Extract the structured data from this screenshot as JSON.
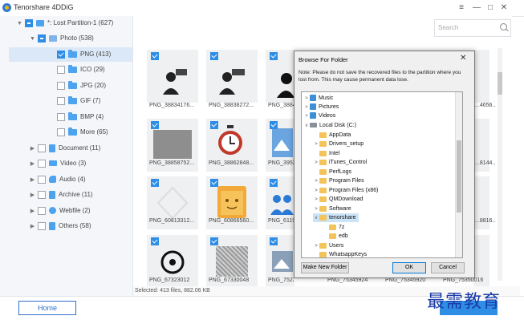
{
  "app": {
    "title": "Tenorshare 4DDiG"
  },
  "window_controls": {
    "menu": "≡",
    "minimize": "—",
    "maximize": "□",
    "close": "✕"
  },
  "sidebar": {
    "root": {
      "label": "Lost Partition-1",
      "count": "(627)",
      "prefix": "*:"
    },
    "photo": {
      "label": "Photo",
      "count": "(538)"
    },
    "photo_children": [
      {
        "label": "PNG",
        "count": "(413)",
        "checked": true,
        "selected": true
      },
      {
        "label": "ICO",
        "count": "(29)"
      },
      {
        "label": "JPG",
        "count": "(20)"
      },
      {
        "label": "GIF",
        "count": "(7)"
      },
      {
        "label": "BMP",
        "count": "(4)"
      },
      {
        "label": "More",
        "count": "(65)"
      }
    ],
    "categories": [
      {
        "label": "Document",
        "count": "(11)"
      },
      {
        "label": "Video",
        "count": "(3)"
      },
      {
        "label": "Audio",
        "count": "(4)"
      },
      {
        "label": "Archive",
        "count": "(11)"
      },
      {
        "label": "Webfile",
        "count": "(2)"
      },
      {
        "label": "Others",
        "count": "(58)"
      }
    ]
  },
  "search": {
    "placeholder": "Search"
  },
  "thumbnails": [
    {
      "label": "PNG_38834176..."
    },
    {
      "label": "PNG_38838272..."
    },
    {
      "label": "PNG_3884"
    },
    {
      "label": "PNG_38858752..."
    },
    {
      "label": "PNG_38862848..."
    },
    {
      "label": "PNG_3952"
    },
    {
      "label": "PNG_60813312..."
    },
    {
      "label": "PNG_60866560..."
    },
    {
      "label": "PNG_6119"
    },
    {
      "label": "PNG_67323012"
    },
    {
      "label": "PNG_67330048"
    },
    {
      "label": "PNG_75227328"
    }
  ],
  "right_labels": [
    "...4656...",
    "...8144...",
    "...8816..."
  ],
  "bottom_partial_labels": [
    "PNG_75345924",
    "PNG_75345920",
    "PNG_75350016"
  ],
  "status": {
    "text": "Selected: 413 files, 882.06 KB"
  },
  "buttons": {
    "home": "Home"
  },
  "dialog": {
    "title": "Browse For Folder",
    "close": "✕",
    "note": "Note: Please do not save the recovered files to the partition where you lost from. This may cause permanent data lose.",
    "tree": [
      {
        "label": "Music",
        "icon": "music-icon",
        "level": 1,
        "arrow": ">"
      },
      {
        "label": "Pictures",
        "icon": "pictures-icon",
        "level": 1,
        "arrow": ">"
      },
      {
        "label": "Videos",
        "icon": "videos-icon",
        "level": 1,
        "arrow": ">"
      },
      {
        "label": "Local Disk (C:)",
        "icon": "drive-icon",
        "level": 1,
        "arrow": "v"
      },
      {
        "label": "AppData",
        "icon": "folder-icon",
        "level": 2,
        "arrow": ""
      },
      {
        "label": "Drivers_setup",
        "icon": "folder-icon",
        "level": 2,
        "arrow": ">"
      },
      {
        "label": "Intel",
        "icon": "folder-icon",
        "level": 2,
        "arrow": ""
      },
      {
        "label": "iTunes_Control",
        "icon": "folder-icon",
        "level": 2,
        "arrow": ">"
      },
      {
        "label": "PerfLogs",
        "icon": "folder-icon",
        "level": 2,
        "arrow": ""
      },
      {
        "label": "Program Files",
        "icon": "folder-icon",
        "level": 2,
        "arrow": ">"
      },
      {
        "label": "Program Files (x86)",
        "icon": "folder-icon",
        "level": 2,
        "arrow": ">"
      },
      {
        "label": "QMDownload",
        "icon": "folder-icon",
        "level": 2,
        "arrow": ">"
      },
      {
        "label": "Software",
        "icon": "folder-icon",
        "level": 2,
        "arrow": ">"
      },
      {
        "label": "tenorshare",
        "icon": "folder-icon",
        "level": 2,
        "arrow": "v",
        "selected": true
      },
      {
        "label": "7z",
        "icon": "folder-icon",
        "level": 3,
        "arrow": ""
      },
      {
        "label": "edb",
        "icon": "folder-icon",
        "level": 3,
        "arrow": ""
      },
      {
        "label": "Users",
        "icon": "folder-icon",
        "level": 2,
        "arrow": ">"
      },
      {
        "label": "WhatsappKeys",
        "icon": "folder-icon",
        "level": 2,
        "arrow": ""
      }
    ],
    "make_new_folder": "Make New Folder",
    "ok": "OK",
    "cancel": "Cancel"
  },
  "watermark": {
    "text": "最需教育"
  },
  "colors": {
    "accent": "#2e8ee6",
    "selection": "#dbe8f7",
    "brand_blue": "#2b7bd6"
  }
}
